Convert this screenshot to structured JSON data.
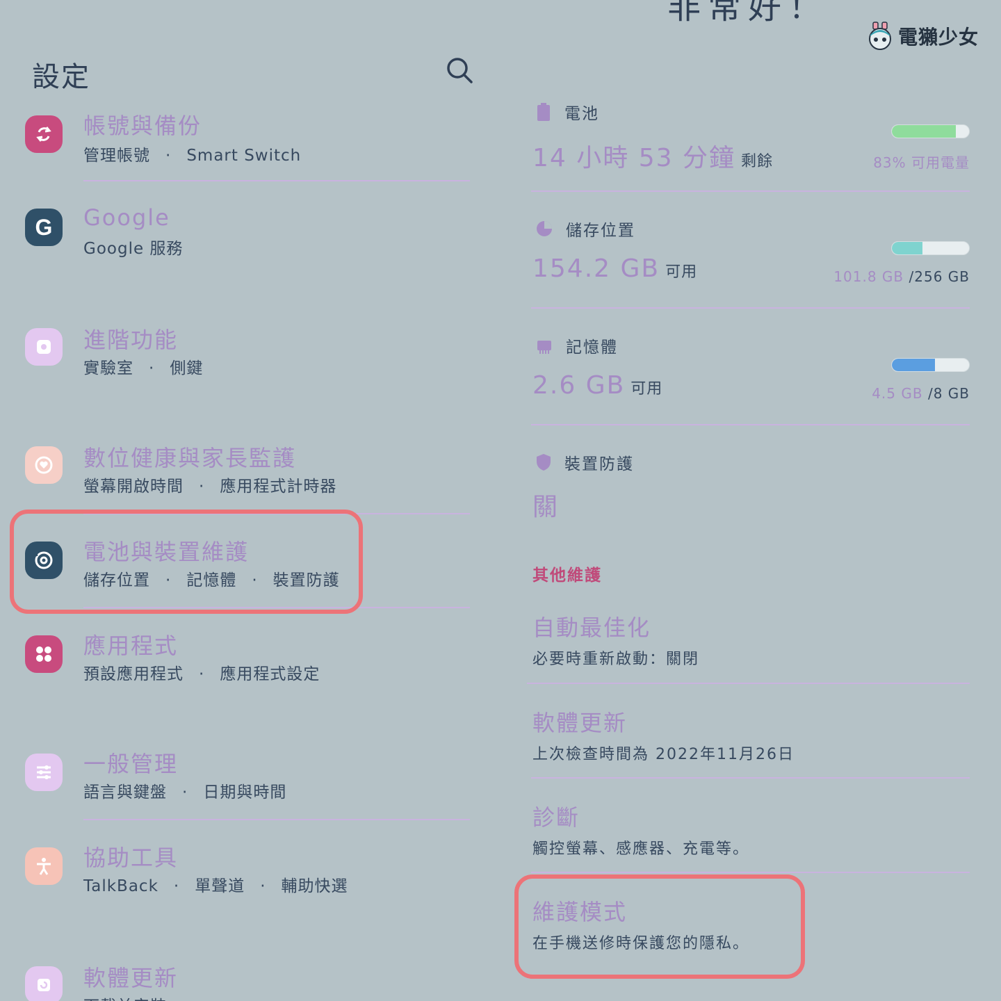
{
  "left": {
    "title": "設定",
    "items": [
      {
        "title": "帳號與備份",
        "sub": [
          "管理帳號",
          "Smart Switch"
        ]
      },
      {
        "title": "Google",
        "sub": [
          "Google 服務"
        ]
      },
      {
        "title": "進階功能",
        "sub": [
          "實驗室",
          "側鍵"
        ]
      },
      {
        "title": "數位健康與家長監護",
        "sub": [
          "螢幕開啟時間",
          "應用程式計時器"
        ]
      },
      {
        "title": "電池與裝置維護",
        "sub": [
          "儲存位置",
          "記憶體",
          "裝置防護"
        ]
      },
      {
        "title": "應用程式",
        "sub": [
          "預設應用程式",
          "應用程式設定"
        ]
      },
      {
        "title": "一般管理",
        "sub": [
          "語言與鍵盤",
          "日期與時間"
        ]
      },
      {
        "title": "協助工具",
        "sub": [
          "TalkBack",
          "單聲道",
          "輔助快選"
        ]
      },
      {
        "title": "軟體更新",
        "sub": [
          "下載並安裝"
        ]
      }
    ]
  },
  "right": {
    "cut_title": "非常好！",
    "brand": "電獺少女",
    "battery": {
      "label": "電池",
      "value": "14 小時 53 分鐘",
      "unit": "剩餘",
      "level": 0.83,
      "caption": "83% 可用電量"
    },
    "storage": {
      "label": "儲存位置",
      "value": "154.2 GB",
      "unit": "可用",
      "level": 0.398,
      "used": "101.8 GB",
      "total": "/256 GB"
    },
    "memory": {
      "label": "記憶體",
      "value": "2.6 GB",
      "unit": "可用",
      "level": 0.5625,
      "used": "4.5 GB",
      "total": "/8 GB"
    },
    "protection": {
      "label": "裝置防護",
      "value": "關"
    },
    "other_label": "其他維護",
    "others": [
      {
        "title": "自動最佳化",
        "sub": "必要時重新啟動：關閉"
      },
      {
        "title": "軟體更新",
        "sub": "上次檢查時間為 2022年11月26日"
      },
      {
        "title": "診斷",
        "sub": "觸控螢幕、感應器、充電等。"
      },
      {
        "title": "維護模式",
        "sub": "在手機送修時保護您的隱私。"
      }
    ]
  },
  "colors": {
    "background": "#b5c2c7",
    "title_purple": "#a58cc4",
    "highlight": "#ec7378",
    "section_pink": "#c04a7a",
    "battery_bar": "#8fdc9c",
    "storage_bar": "#7fd3cf",
    "memory_bar": "#5b9ee0"
  }
}
